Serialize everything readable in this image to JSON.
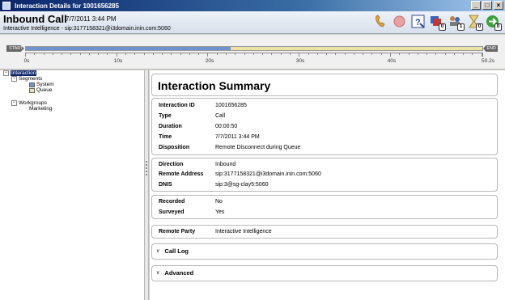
{
  "window": {
    "title": "Interaction Details for 1001656285"
  },
  "header": {
    "title": "Inbound Call",
    "datetime": "7/7/2011 3:44 PM",
    "subtitle": "Interactive Intelligence - sip:3177158321@i3domain.inin.com:5060"
  },
  "toolbar": {
    "icons": [
      "phone-icon",
      "record-icon",
      "help-icon",
      "transfer-icon",
      "conference-icon",
      "hold-icon",
      "forward-icon"
    ],
    "badges": [
      "0",
      "1",
      "0",
      "0"
    ]
  },
  "timeline": {
    "start_label": "START",
    "end_label": "END",
    "total_seconds": 50.2,
    "segments": [
      {
        "name": "System",
        "start": 0,
        "end": 22.5,
        "color": "#6f93cf"
      },
      {
        "name": "Queue",
        "start": 22.5,
        "end": 50.2,
        "color": "#ede3a6"
      }
    ],
    "tick_labels": [
      "0s",
      "10s",
      "20s",
      "30s",
      "40s",
      "50.2s"
    ]
  },
  "tree": {
    "root": "Interaction",
    "segments_label": "Segments",
    "system_label": "System",
    "queue_label": "Queue",
    "workgroups_label": "Workgroups",
    "marketing_label": "Marketing",
    "expand_glyph": "−"
  },
  "summary": {
    "title": "Interaction Summary",
    "id_label": "Interaction ID",
    "id_value": "1001656285",
    "type_label": "Type",
    "type_value": "Call",
    "duration_label": "Duration",
    "duration_value": "00:00:50",
    "time_label": "Time",
    "time_value": "7/7/2011 3:44 PM",
    "disposition_label": "Disposition",
    "disposition_value": "Remote Disconnect during Queue",
    "direction_label": "Direction",
    "direction_value": "Inbound",
    "remote_address_label": "Remote Address",
    "remote_address_value": "sip:3177158321@i3domain.inin.com:5060",
    "dnis_label": "DNIS",
    "dnis_value": "sip:3@sg-clay5:5060",
    "recorded_label": "Recorded",
    "recorded_value": "No",
    "surveyed_label": "Surveyed",
    "surveyed_value": "Yes",
    "remote_party_label": "Remote Party",
    "remote_party_value": "Interactive Intelligence",
    "call_log_label": "Call Log",
    "advanced_label": "Advanced",
    "chevron_glyph": "∨"
  },
  "window_buttons": {
    "minimize": "_",
    "maximize": "□",
    "close": "×"
  }
}
